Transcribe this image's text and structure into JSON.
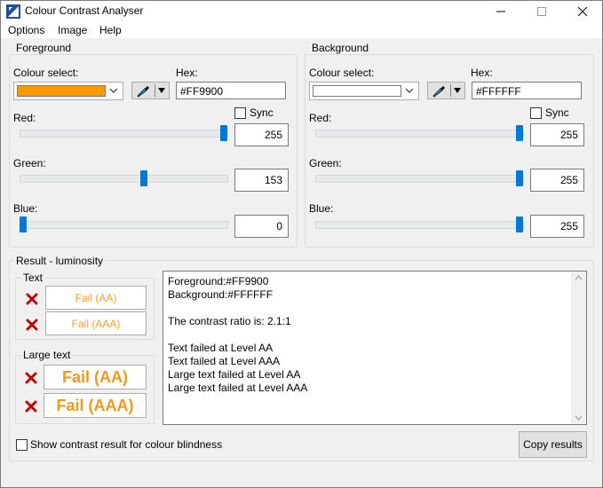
{
  "window": {
    "title": "Colour Contrast Analyser"
  },
  "menu": [
    "Options",
    "Image",
    "Help"
  ],
  "foreground": {
    "group_title": "Foreground",
    "colour_select_label": "Colour select:",
    "swatch_color": "#FF9900",
    "hex_label": "Hex:",
    "hex_value": "#FF9900",
    "sync_label": "Sync",
    "red_label": "Red:",
    "red_value": "255",
    "green_label": "Green:",
    "green_value": "153",
    "blue_label": "Blue:",
    "blue_value": "0"
  },
  "background": {
    "group_title": "Background",
    "colour_select_label": "Colour select:",
    "swatch_color": "#FFFFFF",
    "hex_label": "Hex:",
    "hex_value": "#FFFFFF",
    "sync_label": "Sync",
    "red_label": "Red:",
    "red_value": "255",
    "green_label": "Green:",
    "green_value": "255",
    "blue_label": "Blue:",
    "blue_value": "255"
  },
  "result": {
    "group_title": "Result - luminosity",
    "text_group_title": "Text",
    "text_aa": "Fail (AA)",
    "text_aaa": "Fail (AAA)",
    "large_group_title": "Large text",
    "large_aa": "Fail (AA)",
    "large_aaa": "Fail (AAA)",
    "lines": [
      "Foreground:#FF9900",
      "Background:#FFFFFF",
      "",
      "The contrast ratio is: 2.1:1",
      "",
      "Text failed at Level AA",
      "Text failed at Level AAA",
      "Large text failed at Level AA",
      "Large text failed at Level AAA"
    ],
    "colour_blindness_label": "Show contrast result for colour blindness",
    "copy_button": "Copy results"
  },
  "colors": {
    "fail_text": "#EF9A1F",
    "fail_mark": "#C00000",
    "slider_thumb": "#0078D7"
  }
}
